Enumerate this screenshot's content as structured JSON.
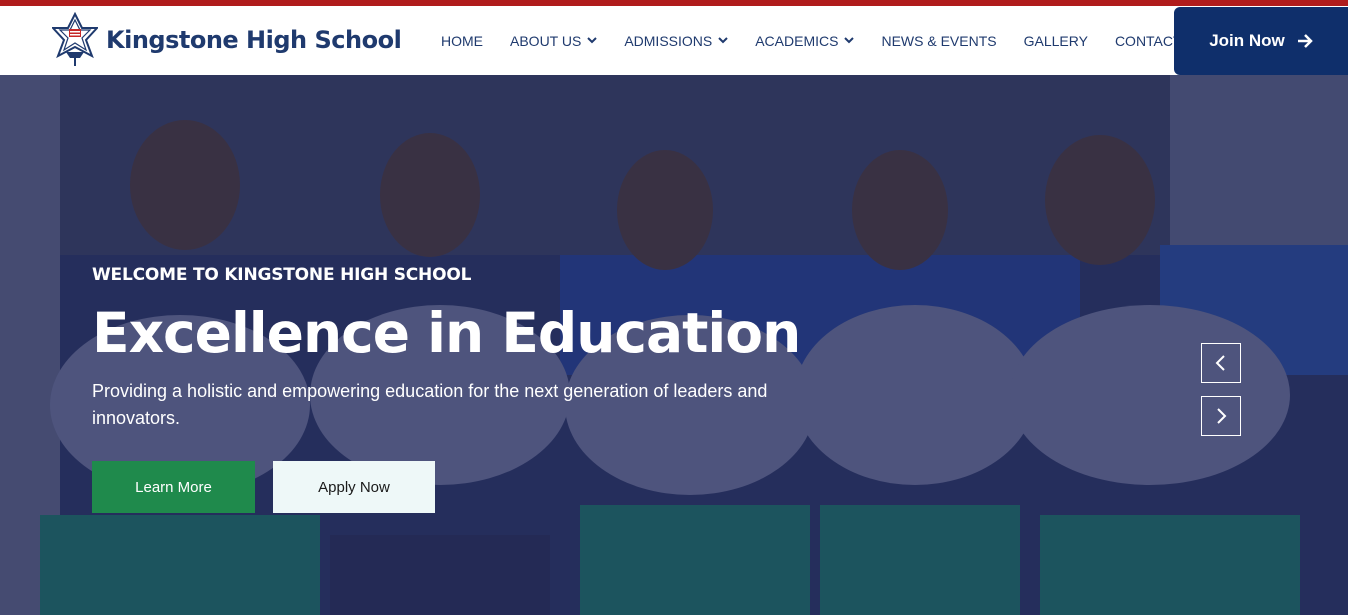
{
  "header": {
    "school_name": "Kingstone High School",
    "logo_icon": "star-crest-logo",
    "nav": [
      {
        "label": "HOME",
        "has_dropdown": false
      },
      {
        "label": "ABOUT US",
        "has_dropdown": true
      },
      {
        "label": "ADMISSIONS",
        "has_dropdown": true
      },
      {
        "label": "ACADEMICS",
        "has_dropdown": true
      },
      {
        "label": "NEWS & EVENTS",
        "has_dropdown": false
      },
      {
        "label": "GALLERY",
        "has_dropdown": false
      },
      {
        "label": "CONTACT US",
        "has_dropdown": false
      }
    ],
    "cta_label": "Join Now",
    "cta_icon": "arrow-right-icon"
  },
  "hero": {
    "eyebrow": "WELCOME TO KINGSTONE HIGH SCHOOL",
    "headline": "Excellence in Education",
    "subtitle": "Providing a holistic and empowering education for the next generation of leaders and innovators.",
    "primary_button": "Learn More",
    "secondary_button": "Apply Now",
    "prev_icon": "chevron-left-icon",
    "next_icon": "chevron-right-icon"
  },
  "colors": {
    "accent_red": "#b01c1c",
    "brand_navy": "#1f3a6e",
    "cta_navy": "#0f2f6b",
    "button_green": "#1f8a4c"
  }
}
